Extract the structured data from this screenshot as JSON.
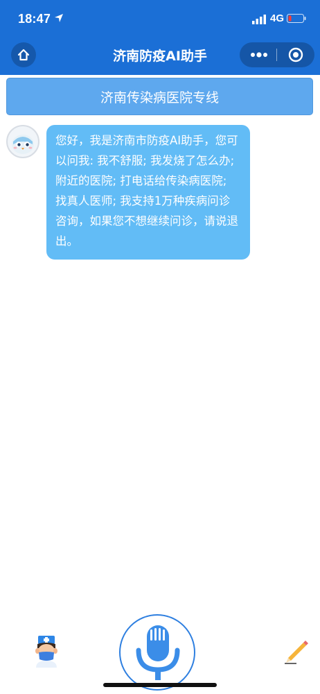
{
  "status_bar": {
    "time": "18:47",
    "network": "4G",
    "icons": [
      "location-arrow-icon",
      "signal-icon",
      "battery-icon"
    ]
  },
  "nav_bar": {
    "title": "济南防疫AI助手",
    "left_icon": "home-icon",
    "capsule_icons": [
      "more-icon",
      "target-icon"
    ]
  },
  "banner": {
    "label": "济南传染病医院专线"
  },
  "chat": {
    "messages": [
      {
        "sender_icon": "bot-avatar-icon",
        "text": "您好，我是济南市防疫AI助手，您可以问我: 我不舒服; 我发烧了怎么办; 附近的医院; 打电话给传染病医院; 找真人医师; 我支持1万种疾病问诊咨询，如果您不想继续问诊，请说退出。"
      }
    ]
  },
  "bottom_bar": {
    "left_icon": "doctor-icon",
    "center_icon": "microphone-icon",
    "right_icon": "pencil-icon"
  },
  "colors": {
    "header": "#1b6fd6",
    "banner": "#5ea8ee",
    "bubble": "#62bcf6",
    "mic": "#2e7fe0"
  }
}
